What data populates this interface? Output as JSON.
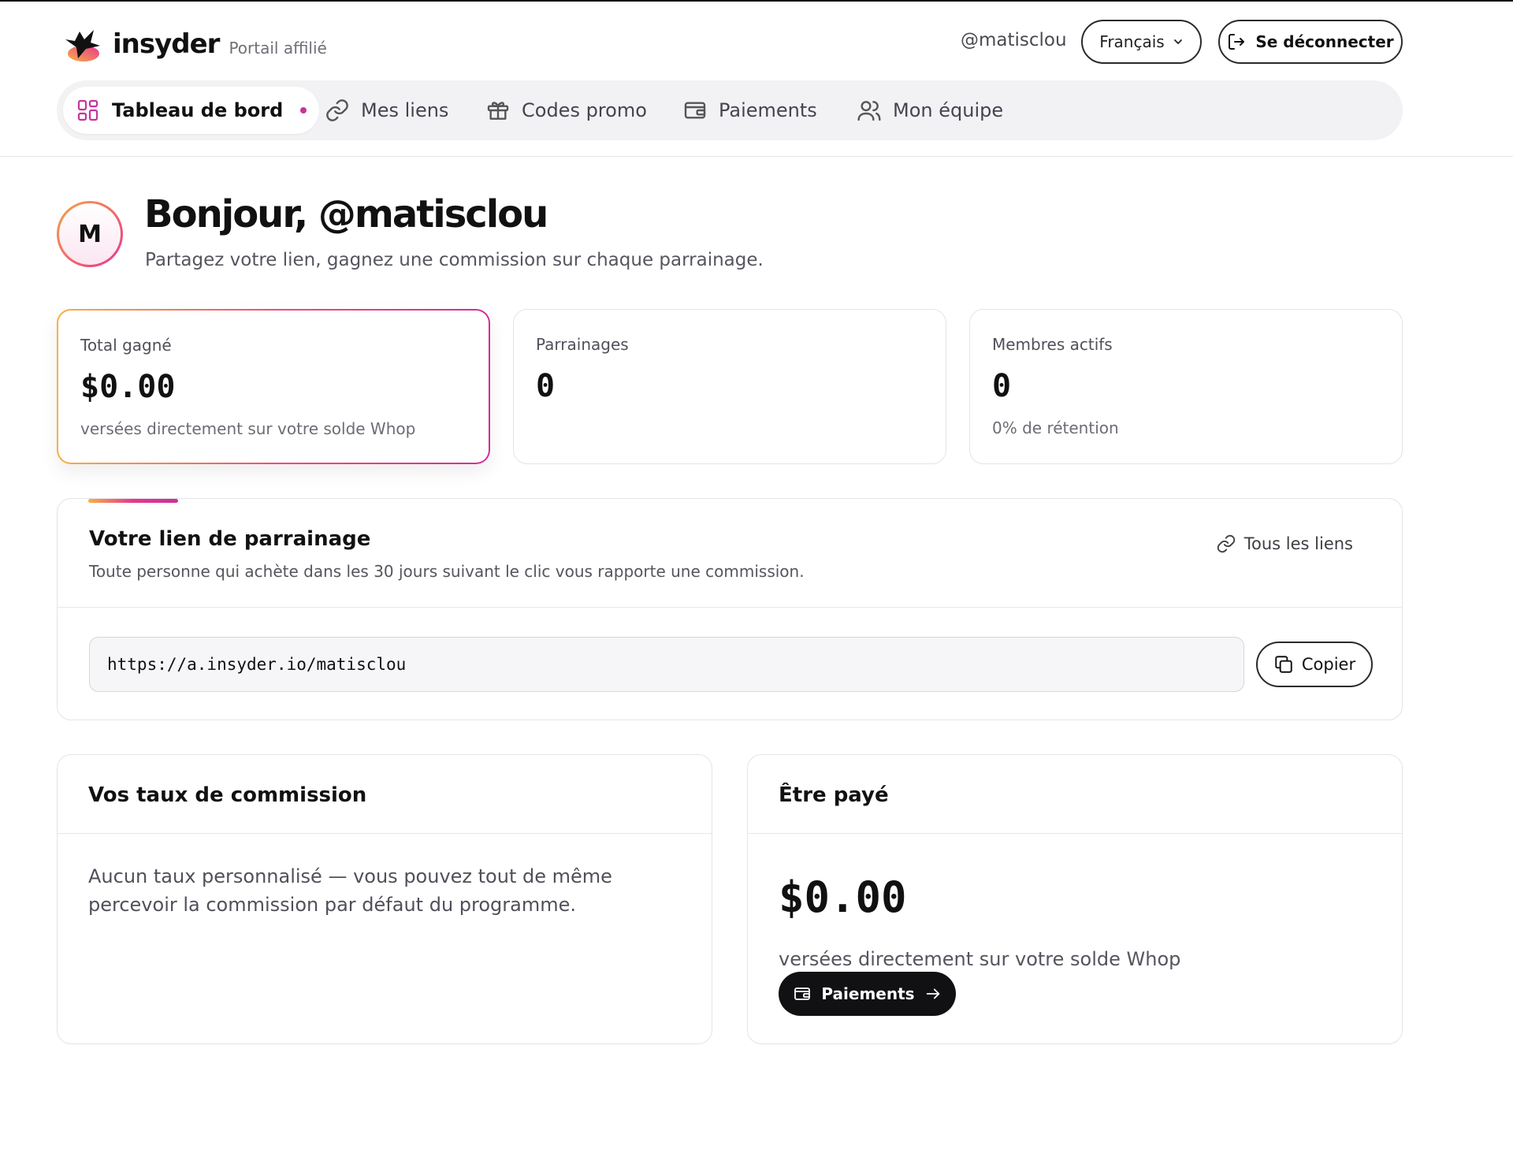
{
  "header": {
    "brand_name": "insyder",
    "brand_sub": "Portail affilié",
    "handle": "@matisclou",
    "language": "Français",
    "logout_label": "Se déconnecter"
  },
  "nav": {
    "items": [
      {
        "label": "Tableau de bord",
        "icon": "grid-icon",
        "active": true
      },
      {
        "label": "Mes liens",
        "icon": "link-icon"
      },
      {
        "label": "Codes promo",
        "icon": "gift-icon"
      },
      {
        "label": "Paiements",
        "icon": "wallet-icon"
      },
      {
        "label": "Mon équipe",
        "icon": "users-icon"
      }
    ]
  },
  "greeting": {
    "avatar_letter": "M",
    "title": "Bonjour, @matisclou",
    "subtitle": "Partagez votre lien, gagnez une commission sur chaque parrainage."
  },
  "stats": [
    {
      "label": "Total gagné",
      "value": "$0.00",
      "note": "versées directement sur votre solde Whop"
    },
    {
      "label": "Parrainages",
      "value": "0",
      "note": ""
    },
    {
      "label": "Membres actifs",
      "value": "0",
      "note": "0% de rétention"
    }
  ],
  "referral": {
    "title": "Votre lien de parrainage",
    "description": "Toute personne qui achète dans les 30 jours suivant le clic vous rapporte une commission.",
    "all_links_label": "Tous les liens",
    "url": "https://a.insyder.io/matisclou",
    "copy_label": "Copier"
  },
  "commission": {
    "title": "Vos taux de commission",
    "body": "Aucun taux personnalisé — vous pouvez tout de même percevoir la commission par défaut du programme."
  },
  "payout": {
    "title": "Être payé",
    "value": "$0.00",
    "note": "versées directement sur votre solde Whop",
    "button_label": "Paiements"
  },
  "colors": {
    "accent_pink": "#c5359b",
    "gradient_start": "#f7b043",
    "gradient_end": "#d12e9c",
    "dark_button": "#111114"
  }
}
